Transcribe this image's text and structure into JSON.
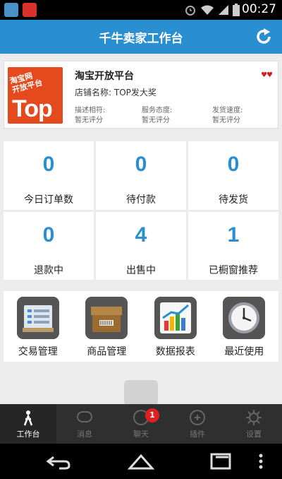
{
  "status_bar": {
    "time": "00:27",
    "icons": [
      "notification-app-icon",
      "notification-taobao-icon",
      "alarm-icon",
      "wifi-icon",
      "signal-icon",
      "battery-icon"
    ]
  },
  "header": {
    "title": "千牛卖家工作台",
    "refresh_icon": "refresh-icon"
  },
  "shop": {
    "logo_sub": "淘宝网\n开放平台",
    "logo_main": "Top",
    "name": "淘宝开放平台",
    "store_label": "店铺名称: TOP发大奖",
    "level_icon": "hearts-icon",
    "ratings": [
      {
        "label": "描述相符:",
        "value": "暂无评分"
      },
      {
        "label": "服务态度:",
        "value": "暂无评分"
      },
      {
        "label": "发货速度:",
        "value": "暂无评分"
      }
    ]
  },
  "stats": [
    {
      "value": "0",
      "label": "今日订单数"
    },
    {
      "value": "0",
      "label": "待付款"
    },
    {
      "value": "0",
      "label": "待发货"
    },
    {
      "value": "0",
      "label": "退款中"
    },
    {
      "value": "4",
      "label": "出售中"
    },
    {
      "value": "1",
      "label": "已橱窗推荐"
    }
  ],
  "shortcuts": [
    {
      "label": "交易管理",
      "icon": "trade-list-icon"
    },
    {
      "label": "商品管理",
      "icon": "goods-box-icon"
    },
    {
      "label": "数据报表",
      "icon": "chart-report-icon"
    },
    {
      "label": "最近使用",
      "icon": "clock-icon"
    }
  ],
  "tabs": [
    {
      "label": "工作台",
      "icon": "workbench-icon",
      "active": true
    },
    {
      "label": "消息",
      "icon": "message-icon"
    },
    {
      "label": "聊天",
      "icon": "chat-icon",
      "badge": "1"
    },
    {
      "label": "插件",
      "icon": "plugin-icon"
    },
    {
      "label": "设置",
      "icon": "settings-gear-icon"
    }
  ],
  "nav": [
    "back-icon",
    "home-icon",
    "recents-icon",
    "menu-dots-icon"
  ],
  "colors": {
    "accent": "#2a8fd0",
    "logo": "#e54a1f",
    "badge": "#e02020"
  }
}
